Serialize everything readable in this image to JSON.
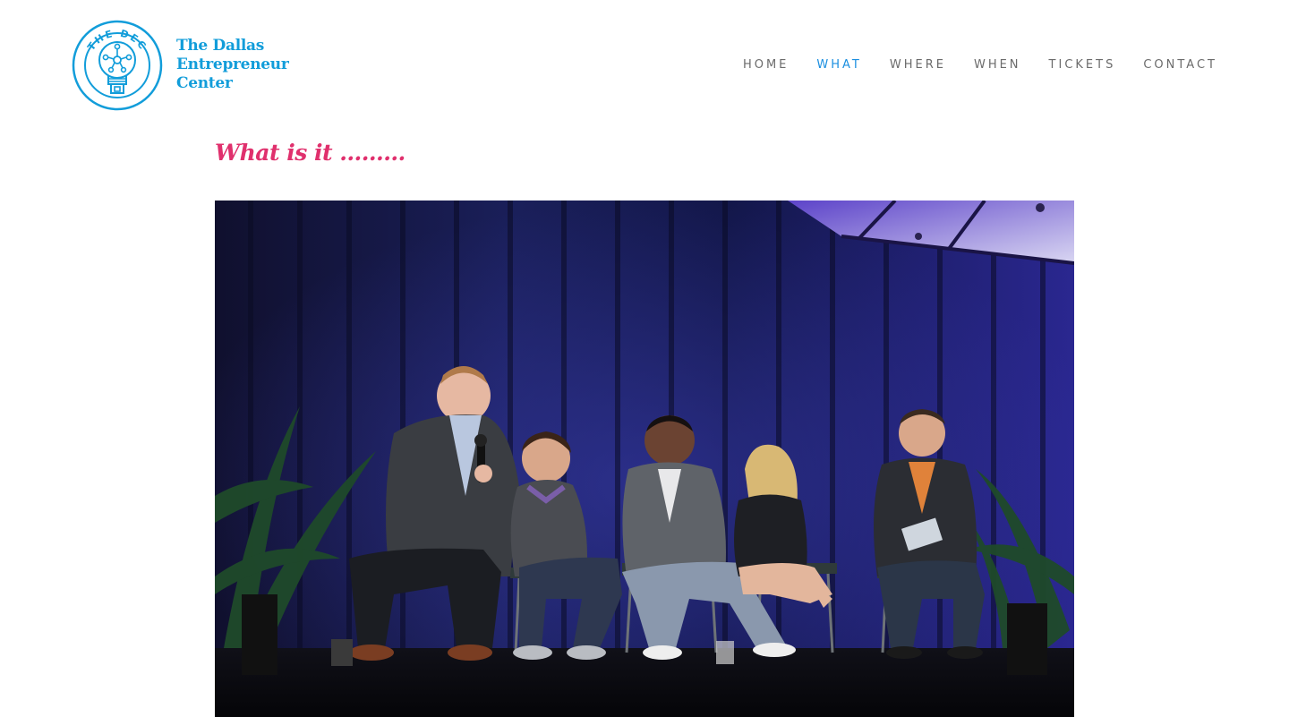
{
  "brand": {
    "name_lines": [
      "The Dallas",
      "Entrepreneur",
      "Center"
    ],
    "badge_text": "THE DEC",
    "color": "#129dda"
  },
  "nav": {
    "items": [
      {
        "label": "HOME",
        "active": false
      },
      {
        "label": "WHAT",
        "active": true
      },
      {
        "label": "WHERE",
        "active": false
      },
      {
        "label": "WHEN",
        "active": false
      },
      {
        "label": "TICKETS",
        "active": false
      },
      {
        "label": "CONTACT",
        "active": false
      }
    ],
    "text_color": "#6b6b6b",
    "active_color": "#1b8fe0"
  },
  "main": {
    "heading": "What is it ………",
    "heading_color": "#e0306d",
    "photo": {
      "subject": "panel-discussion-on-stage",
      "icon": "photo-icon"
    }
  }
}
